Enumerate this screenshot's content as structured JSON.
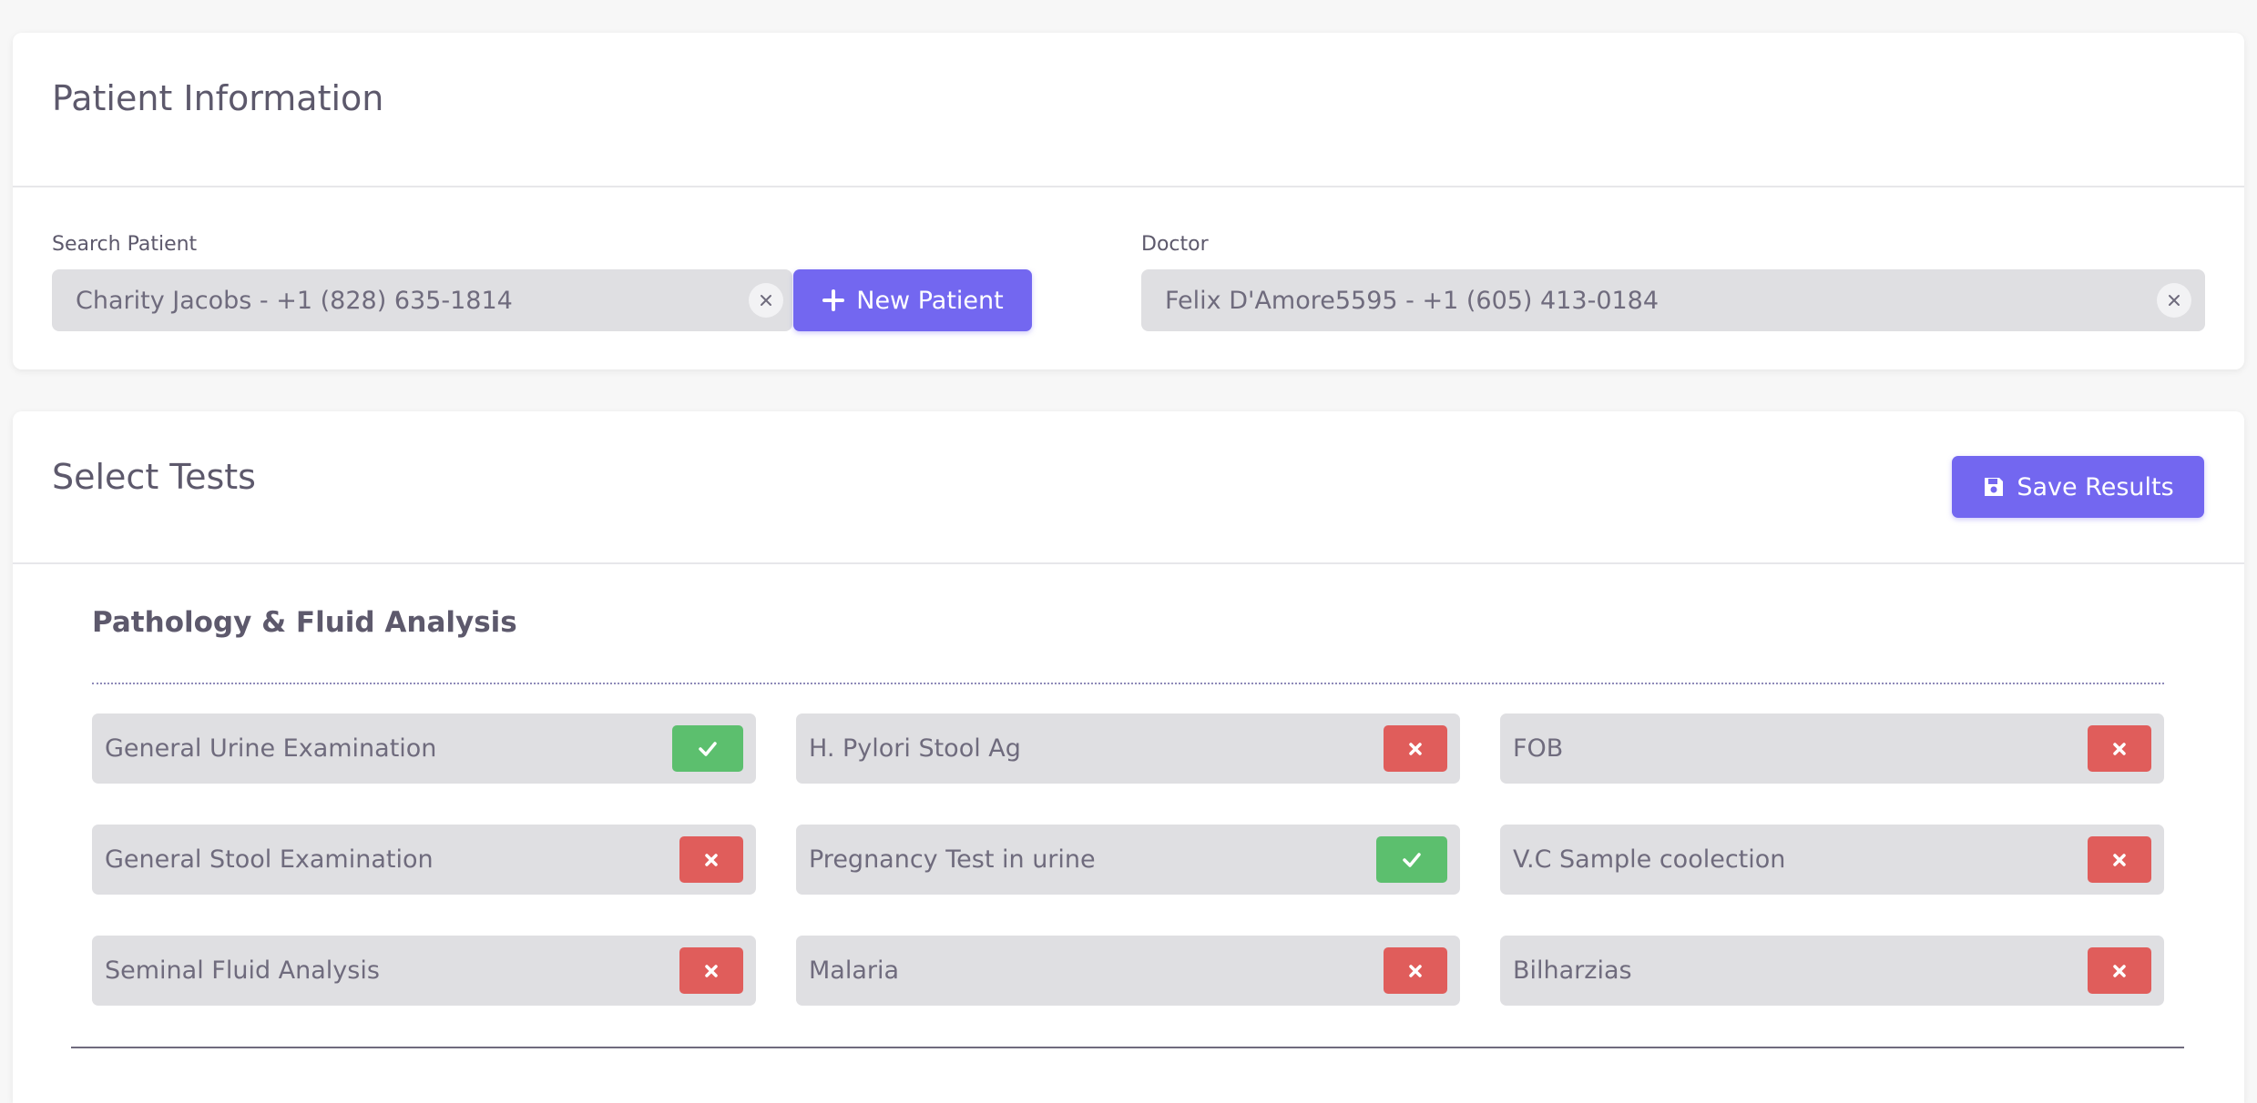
{
  "patient_info": {
    "title": "Patient Information",
    "search_label": "Search Patient",
    "search_value": "Charity Jacobs - +1 (828) 635-1814",
    "new_patient_label": "New Patient",
    "doctor_label": "Doctor",
    "doctor_value": "Felix D'Amore5595 - +1 (605) 413-0184"
  },
  "tests": {
    "title": "Select Tests",
    "save_label": "Save Results",
    "sections": [
      {
        "title": "Pathology & Fluid Analysis",
        "items": [
          {
            "label": "General Urine Examination",
            "selected": true
          },
          {
            "label": "H. Pylori Stool Ag",
            "selected": false
          },
          {
            "label": "FOB",
            "selected": false
          },
          {
            "label": "General Stool Examination",
            "selected": false
          },
          {
            "label": "Pregnancy Test in urine",
            "selected": true
          },
          {
            "label": "V.C Sample coolection",
            "selected": false
          },
          {
            "label": "Seminal Fluid Analysis",
            "selected": false
          },
          {
            "label": "Malaria",
            "selected": false
          },
          {
            "label": "Bilharzias",
            "selected": false
          }
        ]
      }
    ]
  },
  "colors": {
    "primary": "#7367f0",
    "success": "#5cbf6e",
    "danger": "#e05d5b",
    "field_bg": "#dfdfe2"
  },
  "icons": {
    "add": "plus-icon",
    "save": "floppy-disk-icon",
    "clear": "close-icon",
    "selected": "check-icon",
    "unselected": "x-icon"
  }
}
